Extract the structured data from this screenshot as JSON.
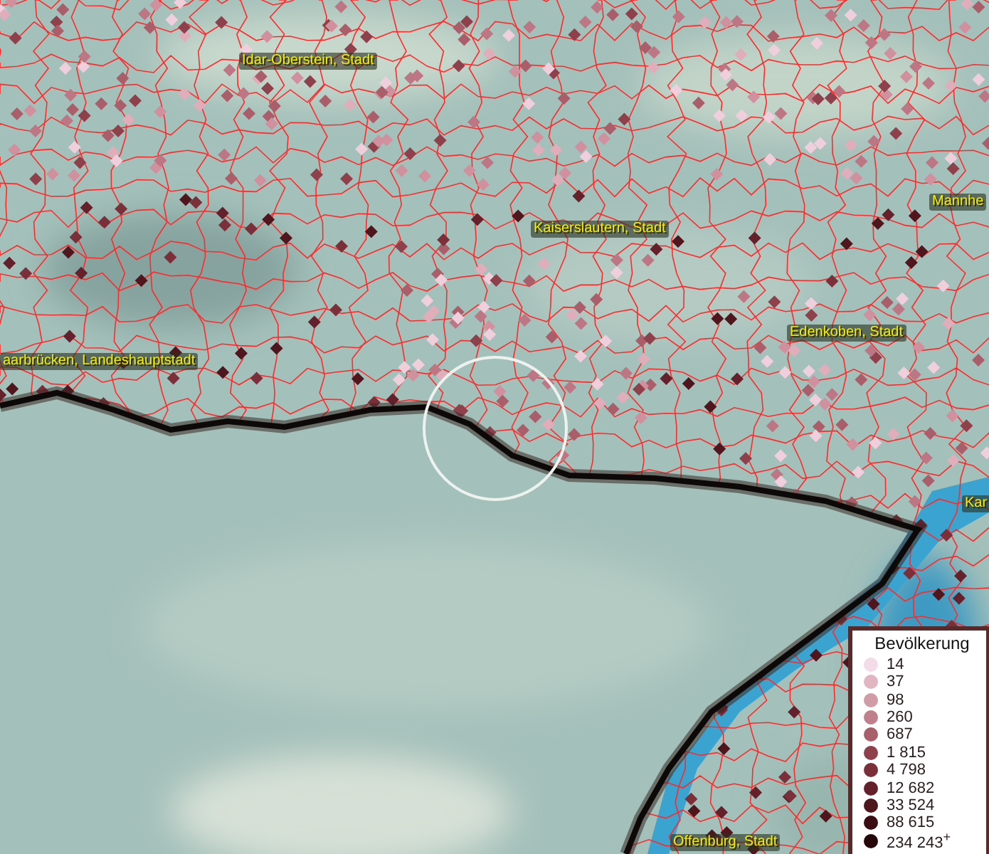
{
  "map": {
    "places": [
      {
        "name": "Idar-Oberstein, Stadt"
      },
      {
        "name": "Kaiserslautern, Stadt"
      },
      {
        "name": "Mannhe"
      },
      {
        "name": "aarbrücken, Landeshauptstadt"
      },
      {
        "name": "Edenkoben, Stadt"
      },
      {
        "name": "Kar"
      },
      {
        "name": "Offenburg, Stadt"
      }
    ]
  },
  "legend": {
    "title": "Bevölkerung",
    "items": [
      {
        "label": "14",
        "color": "#f3dbe7"
      },
      {
        "label": "37",
        "color": "#e2b5c2"
      },
      {
        "label": "98",
        "color": "#d19ba7"
      },
      {
        "label": "260",
        "color": "#bf808c"
      },
      {
        "label": "687",
        "color": "#a95e69"
      },
      {
        "label": "1 815",
        "color": "#8e404b"
      },
      {
        "label": "4 798",
        "color": "#7a2f39"
      },
      {
        "label": "12 682",
        "color": "#64212b"
      },
      {
        "label": "33 524",
        "color": "#4f161e"
      },
      {
        "label": "88 615",
        "color": "#3b0d13"
      },
      {
        "label": "234 243$^{+}$",
        "color": "#26070a"
      }
    ]
  }
}
